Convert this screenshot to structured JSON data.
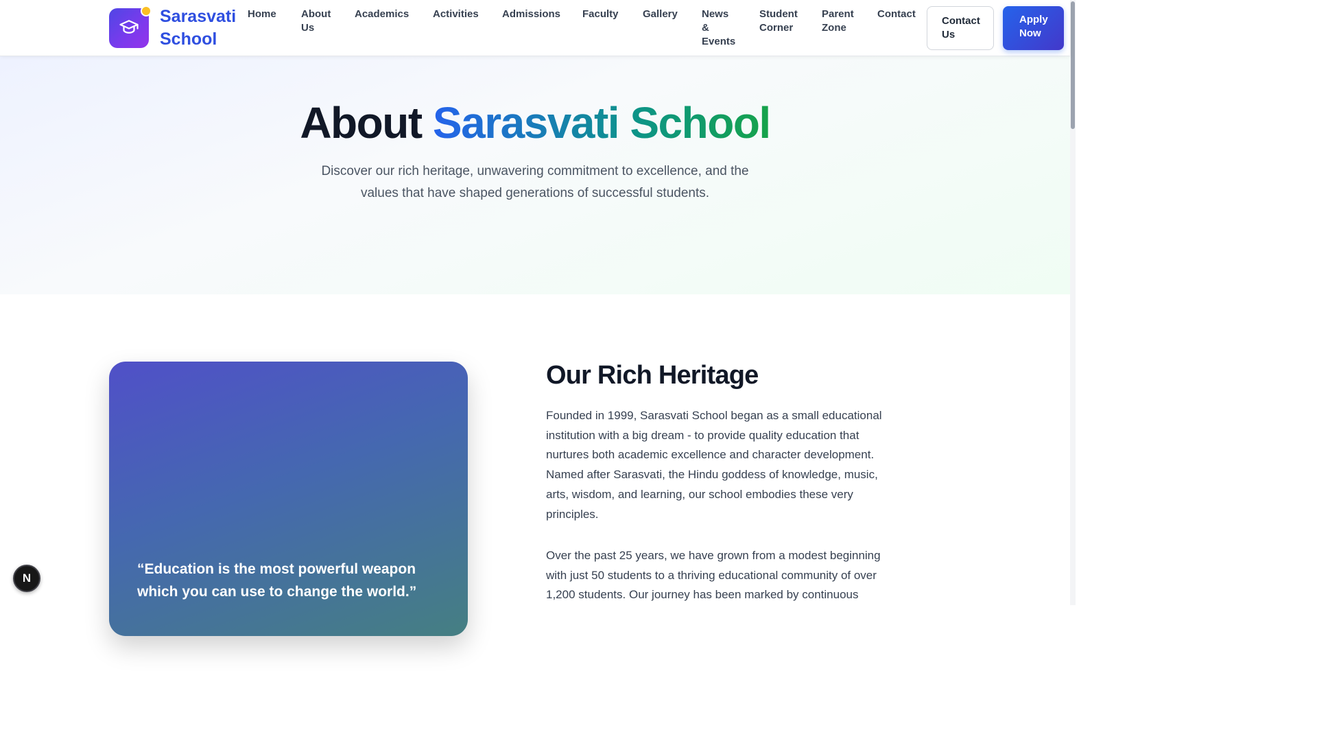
{
  "brand": {
    "line1": "Sarasvati",
    "line2": "School",
    "logo_icon": "graduation-cap-icon"
  },
  "nav": [
    {
      "lines": [
        "Home"
      ]
    },
    {
      "lines": [
        "About",
        "Us"
      ]
    },
    {
      "lines": [
        "Academics"
      ]
    },
    {
      "lines": [
        "Activities"
      ]
    },
    {
      "lines": [
        "Admissions"
      ]
    },
    {
      "lines": [
        "Faculty"
      ]
    },
    {
      "lines": [
        "Gallery"
      ]
    },
    {
      "lines": [
        "News",
        "&",
        "Events"
      ]
    },
    {
      "lines": [
        "Student",
        "Corner"
      ]
    },
    {
      "lines": [
        "Parent",
        "Zone"
      ]
    },
    {
      "lines": [
        "Contact"
      ]
    }
  ],
  "buttons": {
    "contact": {
      "line1": "Contact",
      "line2": "Us"
    },
    "apply": {
      "line1": "Apply",
      "line2": "Now"
    }
  },
  "hero": {
    "title_dark": "About",
    "title_accent": "Sarasvati School",
    "subtitle_line1": "Discover our rich heritage, unwavering commitment to excellence, and the",
    "subtitle_line2": "values that have shaped generations of successful students."
  },
  "heritage": {
    "title": "Our Rich Heritage",
    "paragraph1": [
      "Founded in 1999, Sarasvati School began as a small educational",
      "institution with a big dream - to provide quality education that",
      "nurtures both academic excellence and character development.",
      "Named after Sarasvati, the Hindu goddess of knowledge, music,",
      "arts, wisdom, and learning, our school embodies these very",
      "principles."
    ],
    "paragraph2": [
      "Over the past 25 years, we have grown from a modest beginning",
      "with just 50 students to a thriving educational community of over",
      "1,200 students. Our journey has been marked by continuous"
    ],
    "quote_line1": "“Education is the most powerful weapon",
    "quote_line2": "which you can use to change the world.”"
  },
  "badge": {
    "letter": "N"
  },
  "colors": {
    "brand_blue": "#2f4fe0",
    "apply_button": "#2563eb",
    "logo_purple": "#7c3aed",
    "accent_gradient": [
      "#2563eb",
      "#0d9488",
      "#16a34a"
    ]
  }
}
